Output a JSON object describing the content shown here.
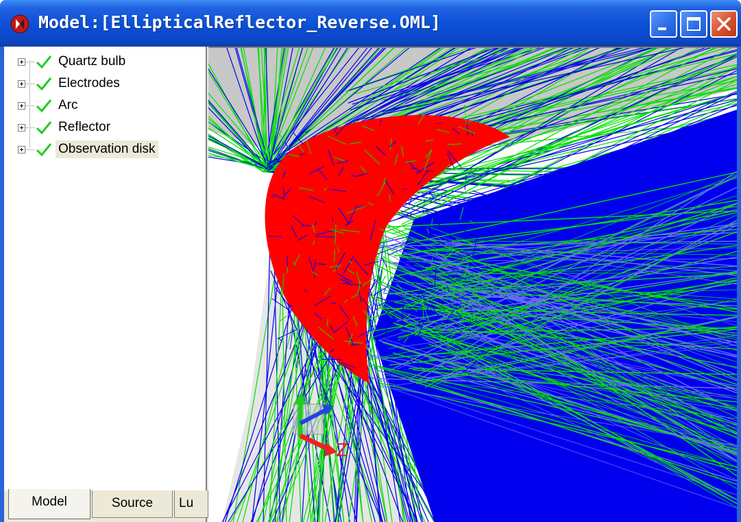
{
  "window": {
    "title": "Model:[EllipticalReflector_Reverse.OML]",
    "buttons": {
      "minimize": "minimize-icon",
      "maximize": "maximize-icon",
      "close": "close-icon"
    }
  },
  "tree": {
    "items": [
      {
        "label": "Quartz bulb",
        "status": "check-icon"
      },
      {
        "label": "Electrodes",
        "status": "check-icon"
      },
      {
        "label": "Arc",
        "status": "check-icon"
      },
      {
        "label": "Reflector",
        "status": "check-icon"
      },
      {
        "label": "Observation disk",
        "status": "check-icon",
        "selected": true
      }
    ]
  },
  "tabs": [
    {
      "label": "Model",
      "active": true
    },
    {
      "label": "Source",
      "active": false
    },
    {
      "label": "Lu",
      "active": false
    }
  ],
  "viewport": {
    "axis_labels": {
      "z": "Z"
    },
    "colors": {
      "ray_blue": "#0000ee",
      "ray_green": "#00e000",
      "reflector_red": "#ff0000",
      "surface_gray": "#c8c8c8",
      "axis_green": "#22cc22",
      "axis_blue": "#2244dd",
      "axis_red": "#ee2222"
    }
  }
}
